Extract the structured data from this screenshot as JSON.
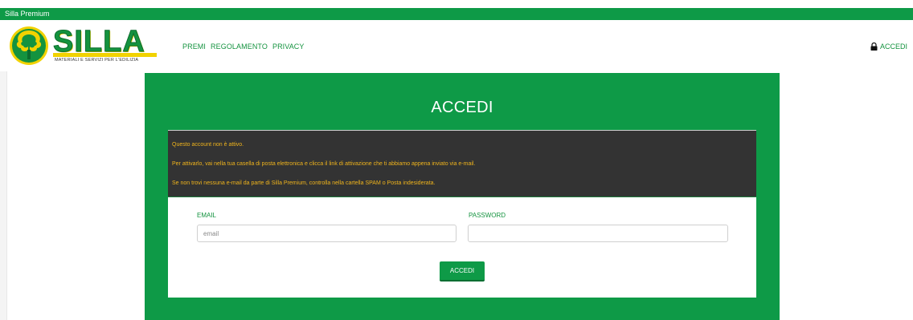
{
  "topbar": {
    "title": "Silla Premium"
  },
  "logo": {
    "word": "SILLA",
    "tagline": "MATERIALI E SERVIZI PER L'EDILIZIA"
  },
  "nav": {
    "items": [
      "PREMI",
      "REGOLAMENTO",
      "PRIVACY"
    ]
  },
  "header": {
    "login_label": "ACCEDI"
  },
  "login": {
    "title": "ACCEDI",
    "alert": [
      "Questo account non è attivo.",
      "Per attivarlo, vai nella tua casella di posta elettronica e clicca il link di attivazione che ti abbiamo appena inviato via e-mail.",
      "Se non trovi nessuna e-mail da parte di Silla Premium, controlla nella cartella SPAM o Posta indesiderata."
    ],
    "email_label": "EMAIL",
    "email_placeholder": "email",
    "password_label": "PASSWORD",
    "password_value": "",
    "submit_label": "ACCEDI"
  },
  "colors": {
    "brand_green": "#0e9a47",
    "brand_yellow": "#f1d200",
    "alert_bg": "#333333",
    "alert_text": "#f0b41c"
  },
  "icons": {
    "lock": "lock-icon",
    "logo": "silla-logo-tree-icon"
  }
}
